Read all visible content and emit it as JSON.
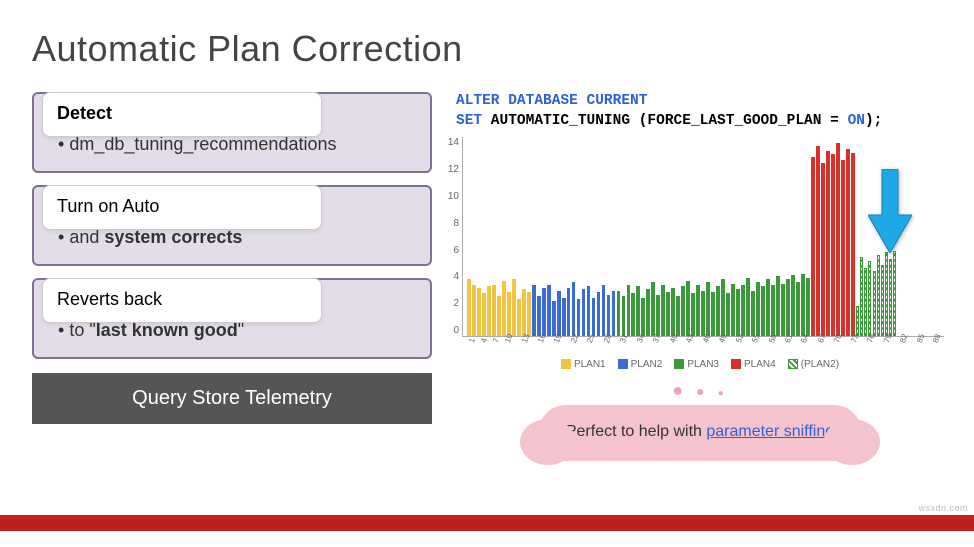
{
  "title": "Automatic Plan Correction",
  "cards": [
    {
      "header_html": "<span class='bold'>Detect</span>",
      "body_html": "dm_db_tuning_recommendations"
    },
    {
      "header_html": "Turn on Auto",
      "body_html": "and <span class='bold'>system corrects</span>"
    },
    {
      "header_html": "Reverts back",
      "body_html": "to \"<span class='quoted'>last known good</span>\""
    }
  ],
  "telemetry": "Query Store Telemetry",
  "code": {
    "line1_kw": "ALTER DATABASE CURRENT",
    "line2_pre": "SET",
    "line2_ident": " AUTOMATIC_TUNING (FORCE_LAST_GOOD_PLAN ",
    "line2_eq": "=",
    "line2_val": " ON",
    "line2_end": ");"
  },
  "cloud_text": "Perfect to help with ",
  "cloud_link": "parameter sniffing",
  "watermark": "wsxdn.com",
  "chart_data": {
    "type": "bar",
    "ylabel_ticks": [
      "14",
      "12",
      "10",
      "8",
      "6",
      "4",
      "2",
      "0"
    ],
    "ylim": [
      0,
      14
    ],
    "legend": [
      "PLAN1",
      "PLAN2",
      "PLAN3",
      "PLAN4",
      "(PLAN2)"
    ],
    "legend_colors": [
      "#f5c342",
      "#3a6bd6",
      "#3a9a3a",
      "#d8312a",
      "hatch-green"
    ],
    "x_shown": [
      1,
      4,
      7,
      10,
      13,
      16,
      19,
      22,
      25,
      28,
      31,
      34,
      37,
      40,
      43,
      46,
      49,
      52,
      55,
      58,
      61,
      64,
      67,
      70,
      73,
      76,
      79,
      82,
      85,
      88
    ],
    "series": [
      {
        "name": "PLAN1",
        "range": [
          1,
          13
        ],
        "values": [
          4,
          3.6,
          3.4,
          3,
          3.5,
          3.6,
          2.8,
          3.9,
          3.1,
          4,
          2.6,
          3.3,
          3.1
        ]
      },
      {
        "name": "PLAN2",
        "range": [
          14,
          30
        ],
        "values": [
          3.6,
          2.8,
          3.4,
          3.6,
          2.5,
          3.2,
          2.7,
          3.4,
          3.8,
          2.6,
          3.3,
          3.5,
          2.7,
          3.1,
          3.6,
          2.9,
          3.2
        ]
      },
      {
        "name": "PLAN3",
        "range": [
          31,
          69
        ],
        "values": [
          3.2,
          2.8,
          3.6,
          3,
          3.5,
          2.7,
          3.3,
          3.8,
          2.9,
          3.6,
          3.1,
          3.4,
          2.8,
          3.5,
          3.9,
          3,
          3.6,
          3.2,
          3.8,
          3.1,
          3.5,
          4,
          3,
          3.7,
          3.3,
          3.6,
          4.1,
          3.2,
          3.8,
          3.5,
          4,
          3.6,
          4.2,
          3.7,
          4,
          4.3,
          3.8,
          4.4,
          4.1
        ]
      },
      {
        "name": "PLAN4",
        "range": [
          70,
          78
        ],
        "values": [
          12.6,
          13.4,
          12.2,
          13,
          12.8,
          13.6,
          12.4,
          13.2,
          12.9
        ]
      },
      {
        "name": "(PLAN2)",
        "range": [
          79,
          88
        ],
        "values": [
          2.1,
          5.6,
          4.8,
          5.3,
          4.6,
          5.7,
          5,
          5.9,
          5.4,
          6
        ]
      }
    ]
  }
}
